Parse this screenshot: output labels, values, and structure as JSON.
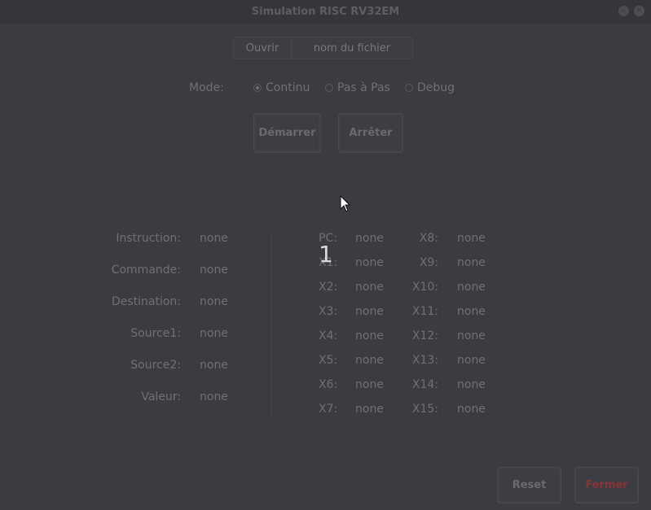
{
  "window": {
    "title": "Simulation RISC RV32EM"
  },
  "file": {
    "open_label": "Ouvrir",
    "filename": "nom du fichier"
  },
  "mode": {
    "label": "Mode:",
    "options": [
      "Continu",
      "Pas à Pas",
      "Debug"
    ],
    "selected": "Continu"
  },
  "controls": {
    "start_label": "Démarrer",
    "stop_label": "Arrêter"
  },
  "overlay": {
    "number": "1"
  },
  "info": [
    {
      "label": "Instruction:",
      "value": "none"
    },
    {
      "label": "Commande:",
      "value": "none"
    },
    {
      "label": "Destination:",
      "value": "none"
    },
    {
      "label": "Source1:",
      "value": "none"
    },
    {
      "label": "Source2:",
      "value": "none"
    },
    {
      "label": "Valeur:",
      "value": "none"
    }
  ],
  "registers_left": [
    {
      "label": "PC:",
      "value": "none"
    },
    {
      "label": "X1:",
      "value": "none"
    },
    {
      "label": "X2:",
      "value": "none"
    },
    {
      "label": "X3:",
      "value": "none"
    },
    {
      "label": "X4:",
      "value": "none"
    },
    {
      "label": "X5:",
      "value": "none"
    },
    {
      "label": "X6:",
      "value": "none"
    },
    {
      "label": "X7:",
      "value": "none"
    }
  ],
  "registers_right": [
    {
      "label": "X8:",
      "value": "none"
    },
    {
      "label": "X9:",
      "value": "none"
    },
    {
      "label": "X10:",
      "value": "none"
    },
    {
      "label": "X11:",
      "value": "none"
    },
    {
      "label": "X12:",
      "value": "none"
    },
    {
      "label": "X13:",
      "value": "none"
    },
    {
      "label": "X14:",
      "value": "none"
    },
    {
      "label": "X15:",
      "value": "none"
    }
  ],
  "footer": {
    "reset_label": "Reset",
    "close_label": "Fermer"
  },
  "colors": {
    "background": "#3b3c42",
    "close_accent": "#8a3434"
  }
}
